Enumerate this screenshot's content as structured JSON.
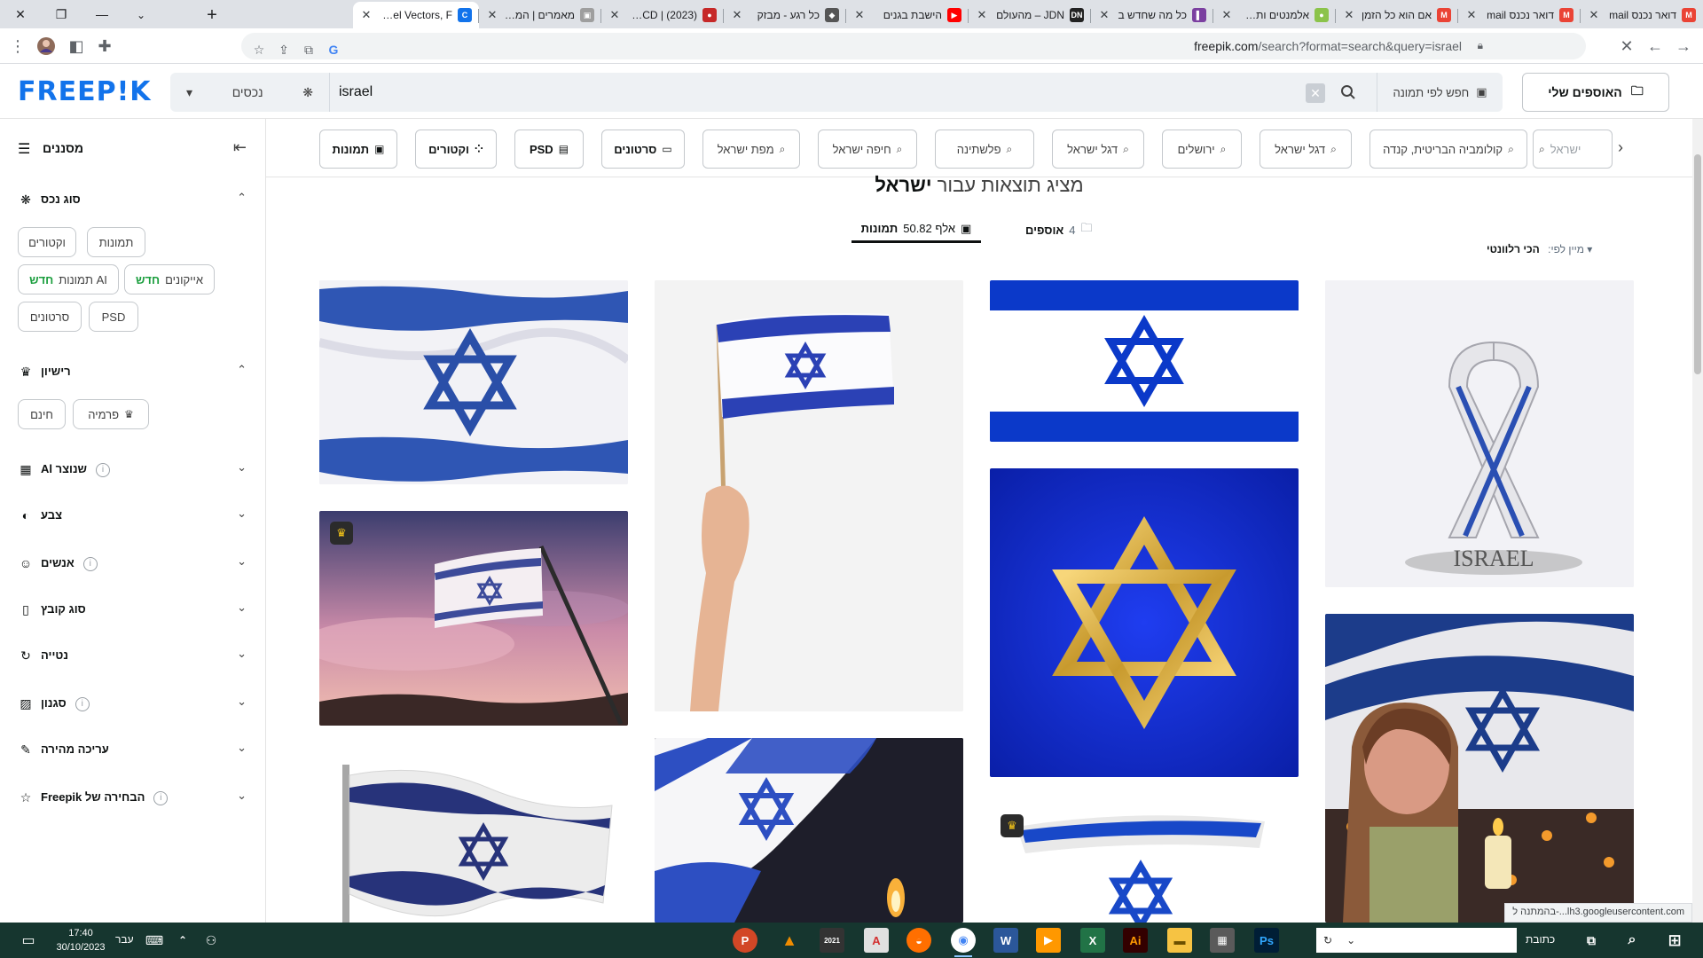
{
  "browser": {
    "tabs": [
      {
        "title": "דואר נכנס mail",
        "fav": "M",
        "color": "#ea4335"
      },
      {
        "title": "דואר נכנס mail",
        "fav": "M",
        "color": "#ea4335"
      },
      {
        "title": "אם הוא כל הזמן",
        "fav": "M",
        "color": "#ea4335"
      },
      {
        "title": "אלמנטים ותמונות",
        "fav": "●",
        "color": "#8bc34a"
      },
      {
        "title": "כל מה שחדש ב",
        "fav": "▌",
        "color": "#7b3fa0"
      },
      {
        "title": "JDN – מהעולם",
        "fav": "DN",
        "color": "#222222"
      },
      {
        "title": "הישבת בגנים",
        "fav": "▶",
        "color": "#ff0000"
      },
      {
        "title": "כל רגע - מבזק",
        "fav": "◆",
        "color": "#555555"
      },
      {
        "title": "OCD | (2023) ת",
        "fav": "●",
        "color": "#c62828"
      },
      {
        "title": "מאמרים | המרכז",
        "fav": "▣",
        "color": "#9e9e9e"
      },
      {
        "title": "Israel Vectors, F",
        "fav": "C",
        "color": "#1273eb"
      }
    ],
    "url_host": "freepik.com",
    "url_rest": "/search?format=search&query=israel"
  },
  "header": {
    "logo": "FREEP!K",
    "asset_select": "נכסים",
    "search_value": "israel",
    "image_search": "חפש לפי תמונה",
    "collections": "האוספים שלי"
  },
  "sidebar": {
    "title": "מסננים",
    "asset_type": {
      "label": "סוג נכס",
      "chips": [
        "וקטורים",
        "תמונות",
        "אייקונים",
        "תמונות AI",
        "PSD",
        "סרטונים"
      ],
      "new_label": "חדש"
    },
    "license": {
      "label": "רישיון",
      "chips": [
        "חינם",
        "פרמיה"
      ]
    },
    "sections": [
      "Al שנוצר",
      "צבע",
      "אנשים",
      "סוג קובץ",
      "נטייה",
      "סגנון",
      "עריכה מהירה",
      "Freepik הבחירה של"
    ]
  },
  "tags": {
    "types": [
      "תמונות",
      "וקטורים",
      "PSD",
      "סרטונים"
    ],
    "related": [
      "מפת ישראל",
      "חיפה ישראל",
      "פלשתינה",
      "דגל ישראל",
      "ירושלים",
      "דגל ישראל",
      "קולומביה הבריטית, קנדה",
      "ישראל"
    ]
  },
  "results": {
    "prefix": "מציג תוצאות עבור",
    "query": "ישראל",
    "tab_collections_count": "4",
    "tab_collections_label": "אוספים",
    "tab_photos_count": "50.82 אלף",
    "tab_photos_label": "תמונות",
    "sort_label": "מיין לפי:",
    "sort_value": "הכי רלוונטי",
    "ribbon_text": "ISRAEL"
  },
  "status_text": "בהמתנה ל-...lh3.googleusercontent.com",
  "taskbar": {
    "time": "17:40",
    "date": "30/10/2023",
    "lang": "עבר",
    "address_label": "כתובת"
  },
  "colors": {
    "brand": "#1273eb",
    "flag_blue": "#0038b8",
    "premium_gold": "#f5c518"
  }
}
